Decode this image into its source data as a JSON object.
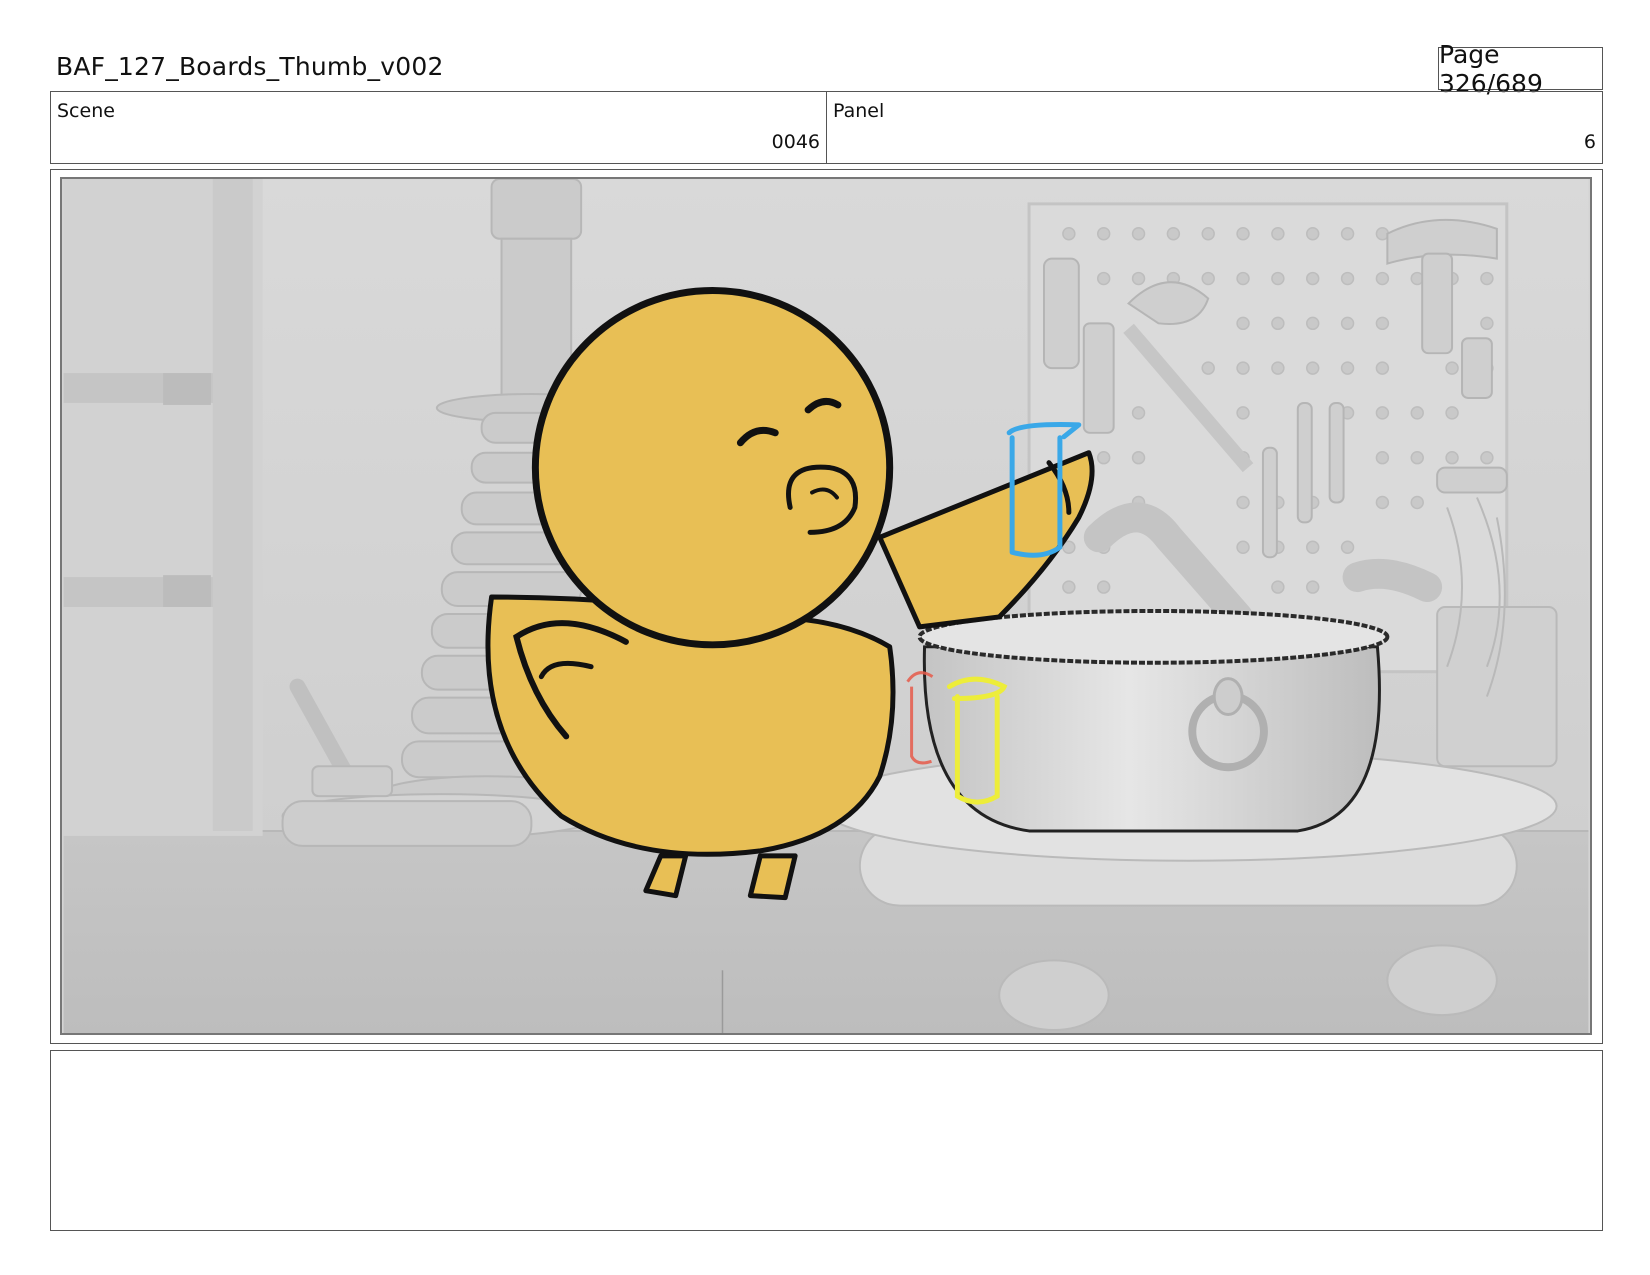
{
  "header": {
    "document_title": "BAF_127_Boards_Thumb_v002",
    "page_label": "Page 326/689"
  },
  "info": {
    "scene_label": "Scene",
    "scene_value": "0046",
    "panel_label": "Panel",
    "panel_value": "6"
  },
  "notes": {
    "text": ""
  },
  "colors": {
    "chick_fill": "#e8bf55",
    "outline": "#111111",
    "blue_sketch": "#3aa8e8",
    "yellow_sketch": "#eded3a",
    "red_sketch": "#e65a4a"
  }
}
